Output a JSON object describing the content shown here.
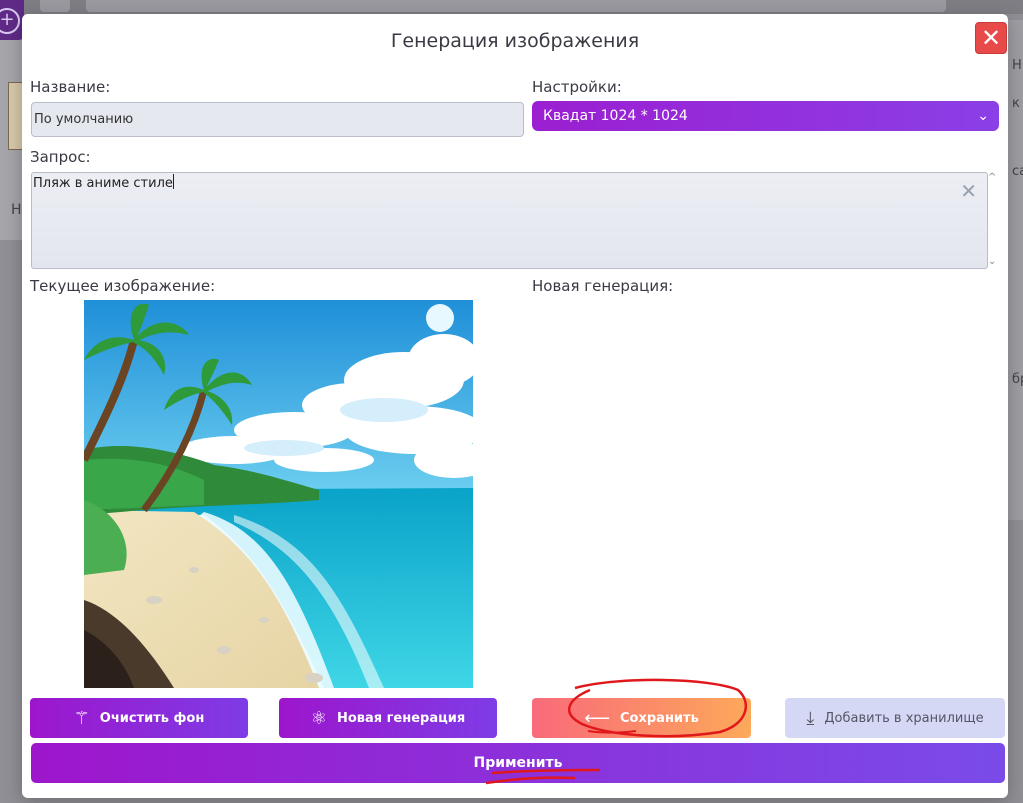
{
  "background": {
    "right_text": [
      "Н",
      "к",
      "са",
      "бр"
    ],
    "left_text": "Н"
  },
  "modal": {
    "title": "Генерация изображения",
    "close_icon": "close-icon",
    "name_label": "Название:",
    "name_value": "По умолчанию",
    "settings_label": "Настройки:",
    "settings_value": "Квадат 1024 * 1024",
    "prompt_label": "Запрос:",
    "prompt_value": "Пляж в аниме стиле",
    "current_image_label": "Текущее изображение:",
    "new_generation_label": "Новая генерация:"
  },
  "buttons": {
    "clear_bg": "Очистить фон",
    "new_generation": "Новая генерация",
    "save": "Сохранить",
    "add_storage": "Добавить в хранилище",
    "apply": "Применить"
  },
  "colors": {
    "accent_purple": "#9d16cc",
    "close_red": "#e84a4a",
    "save_gradient_start": "#f96a7a",
    "save_gradient_end": "#fca95a",
    "annotation_red": "#e0181b"
  }
}
